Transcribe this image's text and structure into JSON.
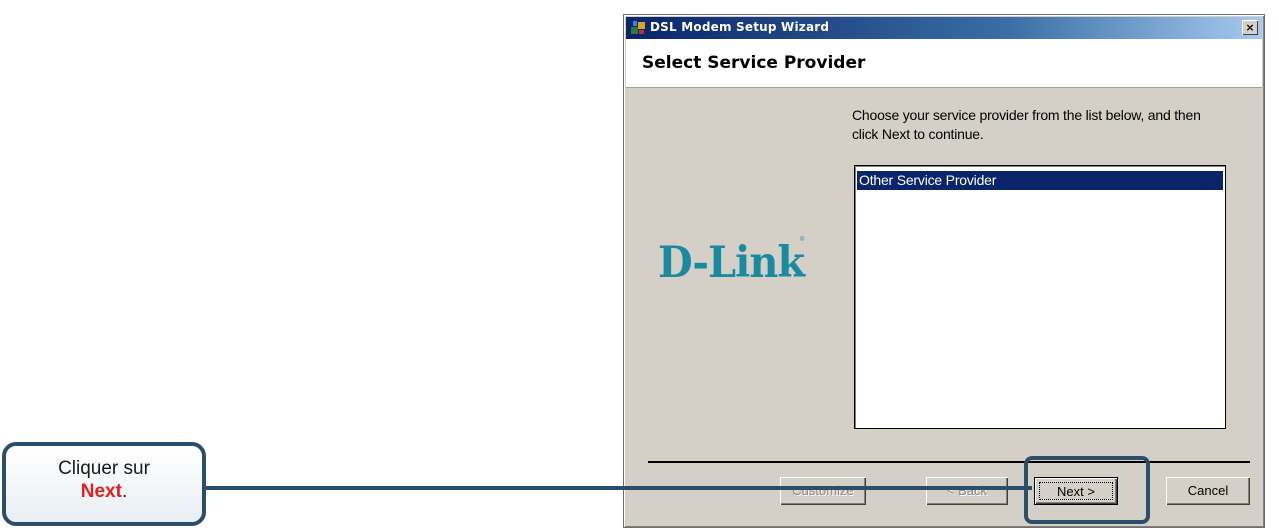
{
  "window": {
    "title": "DSL Modem Setup Wizard",
    "close_glyph": "×"
  },
  "header": {
    "title": "Select Service Provider"
  },
  "brand": {
    "logo_text": "D-Link",
    "logo_mark": "®",
    "logo_color": "#1a8aa0"
  },
  "instructions": "Choose your service provider from the list below, and then click Next to continue.",
  "provider_list": {
    "items": [
      {
        "label": "Other Service Provider",
        "selected": true
      }
    ]
  },
  "buttons": {
    "customize": "Customize",
    "back": "< Back",
    "next": "Next >",
    "cancel": "Cancel"
  },
  "callout": {
    "line1": "Cliquer sur",
    "emphasis": "Next",
    "punct": "."
  },
  "colors": {
    "titlebar_start": "#0a246a",
    "selection": "#0a246a",
    "annotation": "#2b4f6a",
    "emphasis": "#e02020"
  }
}
